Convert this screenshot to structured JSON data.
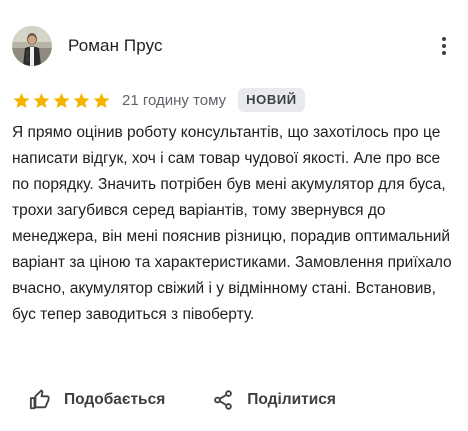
{
  "review": {
    "author": {
      "name": "Роман Прус",
      "avatar_icon": "profile-photo"
    },
    "rating": {
      "stars": 5,
      "max": 5,
      "color": "#f4b400"
    },
    "time": "21 годину тому",
    "badge": "НОВИЙ",
    "text": "Я прямо оцінив роботу консультантів, що захотілось про це написати відгук, хоч і сам товар чудової якості. Але про все по порядку. Значить потрібен був мені акумулятор для буса, трохи загубився серед варіантів, тому звернувся до менеджера, він мені пояснив різницю, порадив оптимальний варіант за ціною та характеристиками. Замовлення приїхало вчасно, акумулятор свіжий і у відмінному стані. Встановив, бус тепер заводиться з півоберту.",
    "actions": {
      "like_label": "Подобається",
      "like_icon": "thumbs-up-icon",
      "share_label": "Поділитися",
      "share_icon": "share-icon"
    },
    "more_icon": "more-vert-icon"
  }
}
